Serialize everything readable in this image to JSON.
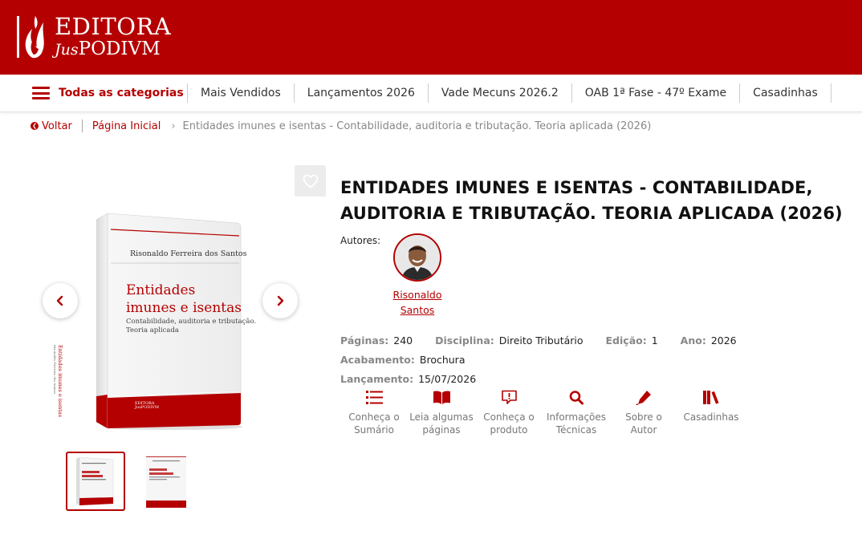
{
  "header": {
    "logo_line1": "EDITORA",
    "logo_jus": "Jus",
    "logo_podivm": "PODIVM"
  },
  "nav": {
    "categories_label": "Todas as categorias",
    "items": [
      "Mais Vendidos",
      "Lançamentos 2026",
      "Vade Mecuns 2026.2",
      "OAB 1ª Fase - 47º Exame",
      "Casadinhas"
    ]
  },
  "breadcrumb": {
    "back": "Voltar",
    "home": "Página Inicial",
    "current": "Entidades imunes e isentas - Contabilidade, auditoria e tributação. Teoria aplicada (2026)"
  },
  "book_cover": {
    "author": "Risonaldo Ferreira dos Santos",
    "title_line1": "Entidades",
    "title_line2": "imunes e isentas",
    "subtitle_line1": "Contabilidade, auditoria e tributação.",
    "subtitle_line2": "Teoria aplicada",
    "spine_text": "Entidades imunes e isentas",
    "spine_author": "Risonaldo Ferreira dos Santos",
    "publisher_line1": "EDITORA",
    "publisher_line2": "JusPODIVM"
  },
  "product": {
    "title": "ENTIDADES IMUNES E ISENTAS - CONTABILIDADE, AUDITORIA E TRIBUTAÇÃO. TEORIA APLICADA (2026)",
    "authors_label": "Autores:",
    "author_line1": "Risonaldo",
    "author_line2": "Santos",
    "specs": [
      {
        "label": "Páginas:",
        "value": "240"
      },
      {
        "label": "Disciplina:",
        "value": "Direito Tributário"
      },
      {
        "label": "Edição:",
        "value": "1"
      },
      {
        "label": "Ano:",
        "value": "2026"
      },
      {
        "label": "Acabamento:",
        "value": "Brochura"
      },
      {
        "label": "Lançamento:",
        "value": "15/07/2026"
      }
    ],
    "actions": [
      {
        "line1": "Conheça o",
        "line2": "Sumário",
        "icon": "list-icon"
      },
      {
        "line1": "Leia algumas",
        "line2": "páginas",
        "icon": "open-book-icon"
      },
      {
        "line1": "Conheça o",
        "line2": "produto",
        "icon": "info-comment-icon"
      },
      {
        "line1": "Informações",
        "line2": "Técnicas",
        "icon": "search-icon"
      },
      {
        "line1": "Sobre o",
        "line2": "Autor",
        "icon": "pen-icon"
      },
      {
        "line1": "Casadinhas",
        "line2": "",
        "icon": "books-icon"
      }
    ]
  },
  "colors": {
    "brand_red": "#b40000",
    "muted_text": "#888888"
  }
}
